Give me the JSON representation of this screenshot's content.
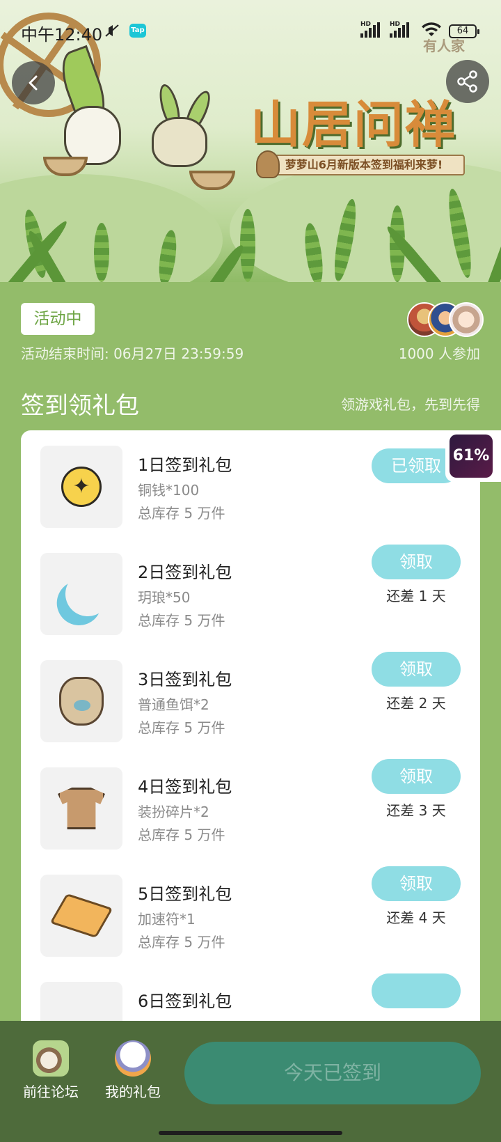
{
  "status_bar": {
    "time": "中午12:40",
    "app_badge": "Tap",
    "battery": "64",
    "watermark": "有人家"
  },
  "banner": {
    "title": "山居问禅",
    "subtitle": "萝萝山6月新版本签到福利来萝!"
  },
  "event": {
    "status": "活动中",
    "end_time": "活动结束时间: 06月27日 23:59:59",
    "participants": "1000 人参加"
  },
  "section": {
    "title": "签到领礼包",
    "hint": "领游戏礼包，先到先得"
  },
  "progress_badge": "61%",
  "gifts": [
    {
      "name": "1日签到礼包",
      "reward": "铜钱*100",
      "stock": "总库存 5 万件",
      "button": "已领取",
      "days_left": ""
    },
    {
      "name": "2日签到礼包",
      "reward": "玥琅*50",
      "stock": "总库存 5 万件",
      "button": "领取",
      "days_left": "还差 1 天"
    },
    {
      "name": "3日签到礼包",
      "reward": "普通鱼饵*2",
      "stock": "总库存 5 万件",
      "button": "领取",
      "days_left": "还差 2 天"
    },
    {
      "name": "4日签到礼包",
      "reward": "装扮碎片*2",
      "stock": "总库存 5 万件",
      "button": "领取",
      "days_left": "还差 3 天"
    },
    {
      "name": "5日签到礼包",
      "reward": "加速符*1",
      "stock": "总库存 5 万件",
      "button": "领取",
      "days_left": "还差 4 天"
    },
    {
      "name": "6日签到礼包",
      "reward": "",
      "stock": "",
      "button": "",
      "days_left": ""
    }
  ],
  "bottom_bar": {
    "forum_label": "前往论坛",
    "gifts_label": "我的礼包",
    "signed_label": "今天已签到"
  },
  "colors": {
    "page_green": "#93bc6a",
    "claim_button": "#8fdde4",
    "bottom_bar": "#4e6b3b",
    "signed_button": "#3b8b72"
  }
}
